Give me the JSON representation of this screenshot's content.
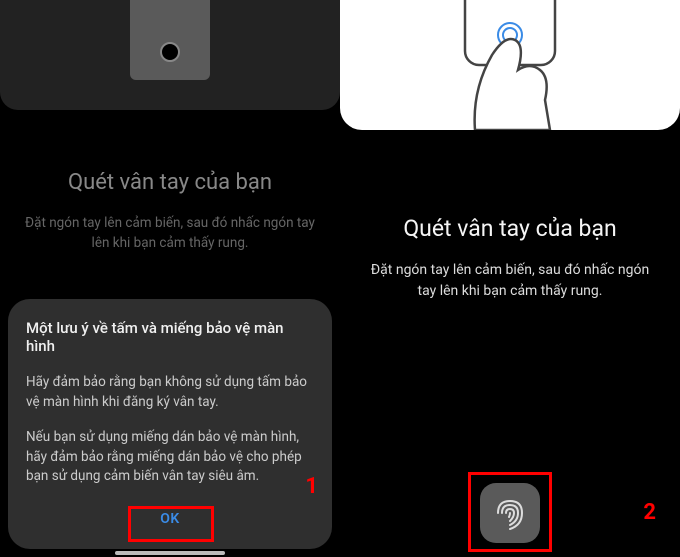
{
  "panel1": {
    "heading": "Quét vân tay của bạn",
    "subtext": "Đặt ngón tay lên cảm biến, sau đó nhấc ngón tay lên khi bạn cảm thấy rung.",
    "step": "1"
  },
  "panel2": {
    "heading": "Quét vân tay của bạn",
    "subtext": "Đặt ngón tay lên cảm biến, sau đó nhấc ngón tay lên khi bạn cảm thấy rung.",
    "step": "2"
  },
  "dialog": {
    "title": "Một lưu ý về tấm và miếng bảo vệ màn hình",
    "para1": "Hãy đảm bảo rằng bạn không sử dụng tấm bảo vệ màn hình khi đăng ký vân tay.",
    "para2": "Nếu bạn sử dụng miếng dán bảo vệ màn hình, hãy đảm bảo rằng miếng dán bảo vệ cho phép bạn sử dụng cảm biến vân tay siêu âm.",
    "ok": "OK"
  }
}
